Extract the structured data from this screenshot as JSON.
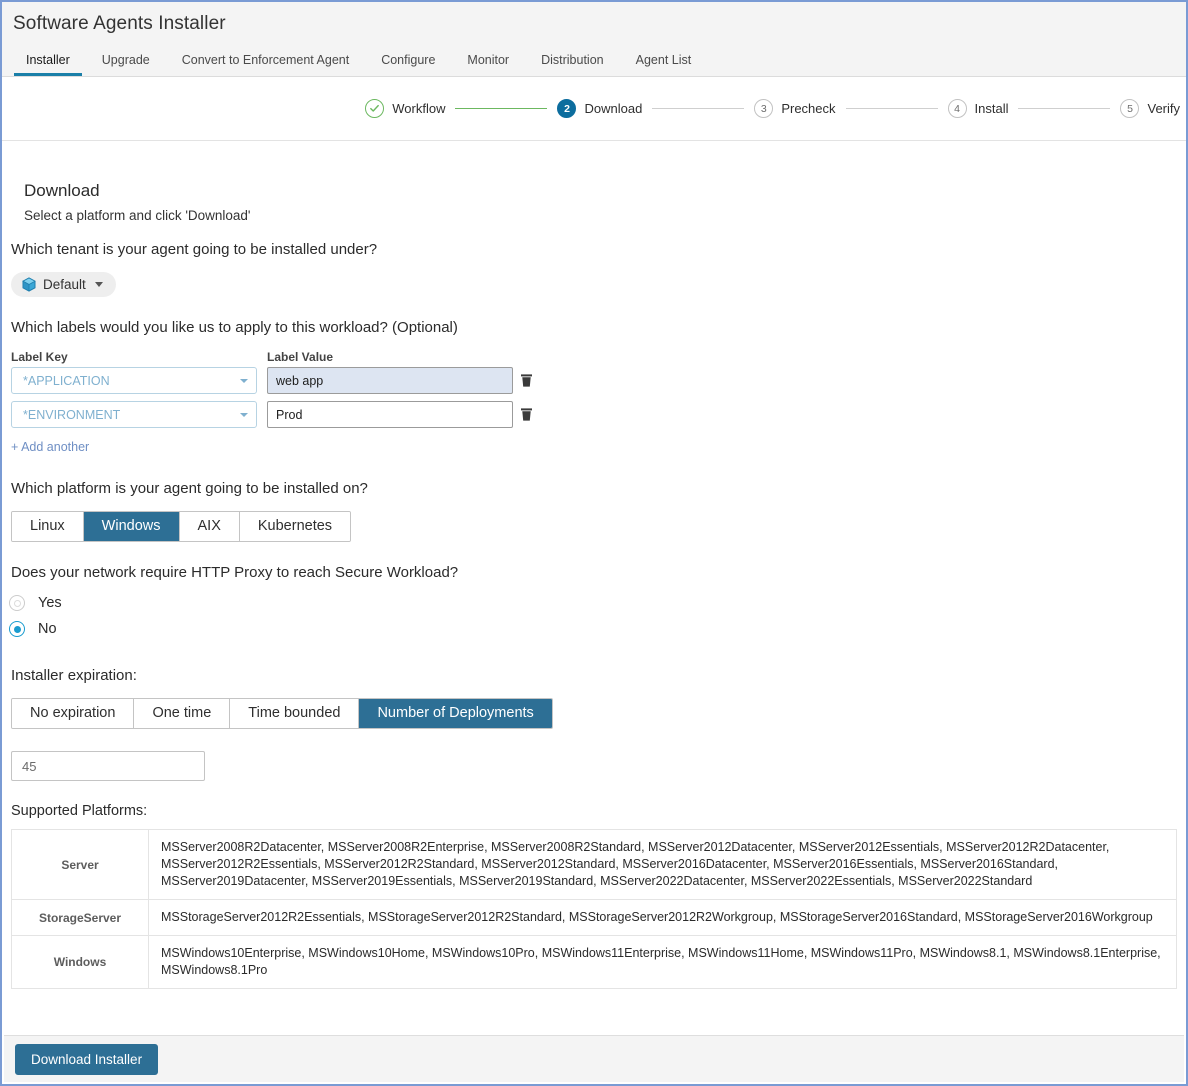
{
  "header": {
    "title": "Software Agents Installer",
    "tabs": [
      {
        "label": "Installer",
        "active": true
      },
      {
        "label": "Upgrade",
        "active": false
      },
      {
        "label": "Convert to Enforcement Agent",
        "active": false
      },
      {
        "label": "Configure",
        "active": false
      },
      {
        "label": "Monitor",
        "active": false
      },
      {
        "label": "Distribution",
        "active": false
      },
      {
        "label": "Agent List",
        "active": false
      }
    ]
  },
  "stepper": {
    "steps": [
      {
        "num": "1",
        "label": "Workflow",
        "state": "done"
      },
      {
        "num": "2",
        "label": "Download",
        "state": "active"
      },
      {
        "num": "3",
        "label": "Precheck",
        "state": "todo"
      },
      {
        "num": "4",
        "label": "Install",
        "state": "todo"
      },
      {
        "num": "5",
        "label": "Verify",
        "state": "todo"
      }
    ]
  },
  "main": {
    "section_title": "Download",
    "section_sub": "Select a platform and click 'Download'",
    "tenant_question": "Which tenant is your agent going to be installed under?",
    "tenant_value": "Default",
    "labels_question": "Which labels would you like us to apply to this workload? (Optional)",
    "label_key_header": "Label Key",
    "label_value_header": "Label Value",
    "label_rows": [
      {
        "key": "*APPLICATION",
        "value": "web app",
        "focused": true
      },
      {
        "key": "*ENVIRONMENT",
        "value": "Prod",
        "focused": false
      }
    ],
    "add_another": "+ Add another",
    "platform_question": "Which platform is your agent going to be installed on?",
    "platforms": [
      {
        "label": "Linux",
        "active": false
      },
      {
        "label": "Windows",
        "active": true
      },
      {
        "label": "AIX",
        "active": false
      },
      {
        "label": "Kubernetes",
        "active": false
      }
    ],
    "proxy_question": "Does your network require HTTP Proxy to reach Secure Workload?",
    "proxy_options": [
      {
        "label": "Yes",
        "checked": false
      },
      {
        "label": "No",
        "checked": true
      }
    ],
    "expiration_label": "Installer expiration:",
    "expiration_options": [
      {
        "label": "No expiration",
        "active": false
      },
      {
        "label": "One time",
        "active": false
      },
      {
        "label": "Time bounded",
        "active": false
      },
      {
        "label": "Number of Deployments",
        "active": true
      }
    ],
    "deployment_count": "45",
    "supported_platforms_title": "Supported Platforms:",
    "supported_platforms": [
      {
        "name": "Server",
        "list": "MSServer2008R2Datacenter, MSServer2008R2Enterprise, MSServer2008R2Standard, MSServer2012Datacenter, MSServer2012Essentials, MSServer2012R2Datacenter, MSServer2012R2Essentials, MSServer2012R2Standard, MSServer2012Standard, MSServer2016Datacenter, MSServer2016Essentials, MSServer2016Standard, MSServer2019Datacenter, MSServer2019Essentials, MSServer2019Standard, MSServer2022Datacenter, MSServer2022Essentials, MSServer2022Standard"
      },
      {
        "name": "StorageServer",
        "list": "MSStorageServer2012R2Essentials, MSStorageServer2012R2Standard, MSStorageServer2012R2Workgroup, MSStorageServer2016Standard, MSStorageServer2016Workgroup"
      },
      {
        "name": "Windows",
        "list": "MSWindows10Enterprise, MSWindows10Home, MSWindows10Pro, MSWindows11Enterprise, MSWindows11Home, MSWindows11Pro, MSWindows8.1, MSWindows8.1Enterprise, MSWindows8.1Pro"
      }
    ]
  },
  "footer": {
    "download_button": "Download Installer"
  },
  "colors": {
    "accent_blue": "#2d6f95",
    "active_step": "#0c6d9e",
    "done_green": "#6cb860",
    "radio_checked": "#1a9ccf",
    "tab_underline": "#1a7fa8",
    "label_key_blue": "#7fb0cf",
    "link_blue": "#6f8fc4",
    "focused_input_bg": "#dde5f2"
  }
}
